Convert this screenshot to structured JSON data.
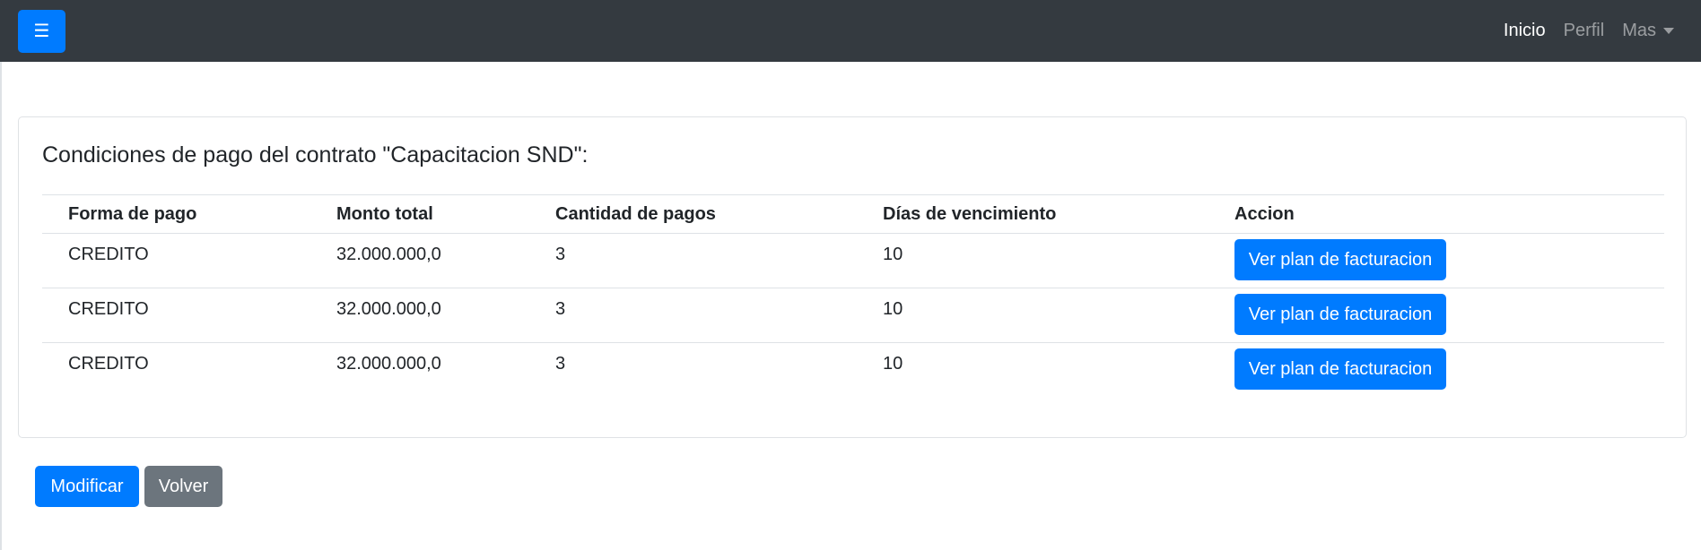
{
  "navbar": {
    "menu_icon": "☰",
    "links": [
      {
        "label": "Inicio",
        "active": true
      },
      {
        "label": "Perfil",
        "active": false
      },
      {
        "label": "Mas",
        "active": false,
        "dropdown": true
      }
    ]
  },
  "card": {
    "title": "Condiciones de pago del contrato \"Capacitacion SND\":",
    "table": {
      "headers": [
        "Forma de pago",
        "Monto total",
        "Cantidad de pagos",
        "Días de vencimiento",
        "Accion"
      ],
      "rows": [
        {
          "forma": "CREDITO",
          "monto": "32.000.000,0",
          "cantidad": "3",
          "dias": "10",
          "action_label": "Ver plan de facturacion"
        },
        {
          "forma": "CREDITO",
          "monto": "32.000.000,0",
          "cantidad": "3",
          "dias": "10",
          "action_label": "Ver plan de facturacion"
        },
        {
          "forma": "CREDITO",
          "monto": "32.000.000,0",
          "cantidad": "3",
          "dias": "10",
          "action_label": "Ver plan de facturacion"
        }
      ]
    }
  },
  "footer": {
    "modify_label": "Modificar",
    "back_label": "Volver"
  },
  "colors": {
    "navbar_bg": "#343a40",
    "primary": "#007bff",
    "secondary": "#6c757d"
  }
}
